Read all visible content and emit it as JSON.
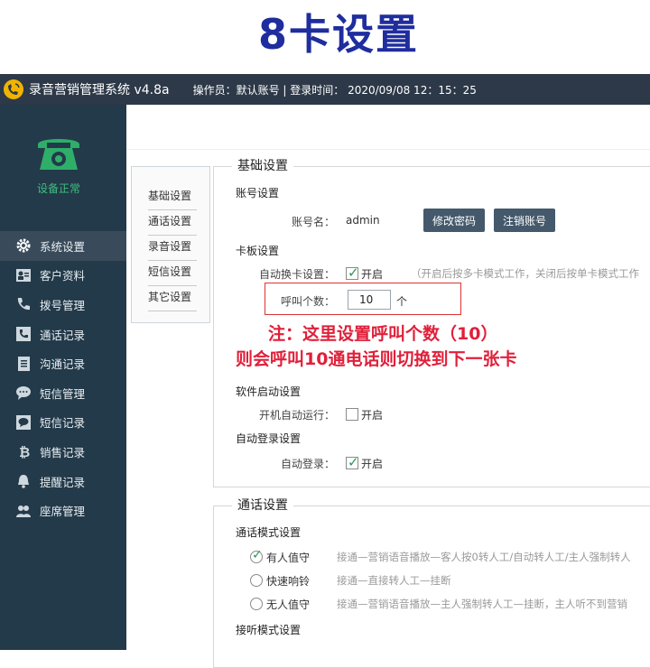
{
  "banner": {
    "title": "8卡设置"
  },
  "titlebar": {
    "app_title": "录音营销管理系统 v4.8a",
    "operator_text": "操作员：默认账号 | 登录时间：  2020/09/08  12：15：25"
  },
  "sidebar": {
    "device_status": "设备正常",
    "items": [
      {
        "label": "系统设置",
        "icon": "gear-icon"
      },
      {
        "label": "客户资料",
        "icon": "contact-card-icon"
      },
      {
        "label": "拨号管理",
        "icon": "phone-handset-icon"
      },
      {
        "label": "通话记录",
        "icon": "call-log-icon"
      },
      {
        "label": "沟通记录",
        "icon": "notebook-icon"
      },
      {
        "label": "短信管理",
        "icon": "chat-bubble-icon"
      },
      {
        "label": "短信记录",
        "icon": "message-log-icon"
      },
      {
        "label": "销售记录",
        "icon": "bitcoin-icon"
      },
      {
        "label": "提醒记录",
        "icon": "bell-icon"
      },
      {
        "label": "座席管理",
        "icon": "users-icon"
      }
    ]
  },
  "submenu": [
    "基础设置",
    "通话设置",
    "录音设置",
    "短信设置",
    "其它设置"
  ],
  "basic": {
    "title": "基础设置",
    "account_heading": "账号设置",
    "account_label": "账号名：",
    "account_value": "admin",
    "change_password": "修改密码",
    "logout_account": "注销账号",
    "card_heading": "卡板设置",
    "auto_switch_label": "自动换卡设置：",
    "auto_switch_on": "开启",
    "auto_switch_hint": "（开启后按多卡模式工作，关闭后按单卡模式工作",
    "call_count_label": "呼叫个数：",
    "call_count_value": "10",
    "call_count_unit": "个",
    "annotation_line1": "注：这里设置呼叫个数（10）",
    "annotation_line2": "则会呼叫10通电话则切换到下一张卡",
    "software_heading": "软件启动设置",
    "autostart_label": "开机自动运行：",
    "autostart_on": "开启",
    "autologin_heading": "自动登录设置",
    "autologin_label": "自动登录：",
    "autologin_on": "开启"
  },
  "call": {
    "title": "通话设置",
    "mode_heading": "通话模式设置",
    "modes": [
      {
        "label": "有人值守",
        "desc": "接通—营销语音播放—客人按0转人工/自动转人工/主人强制转人",
        "checked": true
      },
      {
        "label": "快速响铃",
        "desc": "接通—直接转人工—挂断",
        "checked": false
      },
      {
        "label": "无人值守",
        "desc": "接通—营销语音播放—主人强制转人工—挂断，主人听不到营销",
        "checked": false
      }
    ],
    "answer_heading": "接听模式设置"
  },
  "colors": {
    "titlebar": "#2d3948",
    "sidebar": "#233a4a",
    "button": "#44596b",
    "annotation": "#e0203a",
    "banner": "#1f2d9e",
    "status": "#3fbf7f"
  }
}
